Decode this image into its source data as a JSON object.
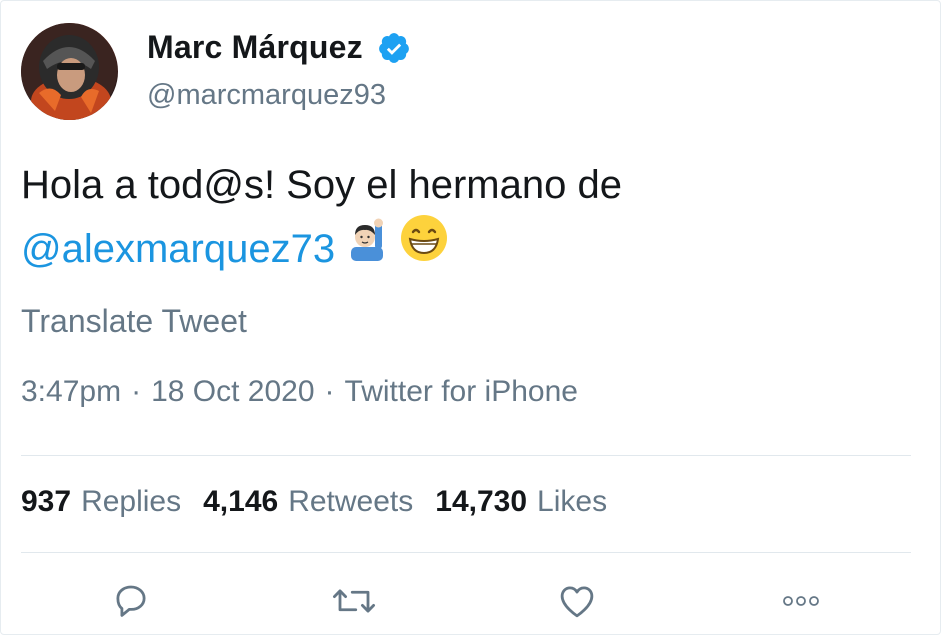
{
  "author": {
    "display_name": "Marc Márquez",
    "handle": "@marcmarquez93",
    "verified": true,
    "avatar_icon": "rider-helmet-avatar"
  },
  "tweet": {
    "text_line1": "Hola a tod@s! Soy el hermano de",
    "mention": "@alexmarquez73",
    "emojis": [
      "man-raising-hand-emoji",
      "grinning-face-emoji"
    ]
  },
  "translate_label": "Translate Tweet",
  "meta": {
    "time": "3:47pm",
    "separator": "·",
    "date": "18 Oct 2020",
    "source": "Twitter for iPhone"
  },
  "stats": {
    "replies_count": "937",
    "replies_label": "Replies",
    "retweets_count": "4,146",
    "retweets_label": "Retweets",
    "likes_count": "14,730",
    "likes_label": "Likes"
  },
  "actions": [
    "reply-icon",
    "retweet-icon",
    "like-icon",
    "more-icon"
  ],
  "colors": {
    "text": "#14171a",
    "secondary": "#657786",
    "link": "#1b95e0",
    "verified": "#1da1f2",
    "divider": "#e1e8ed"
  }
}
